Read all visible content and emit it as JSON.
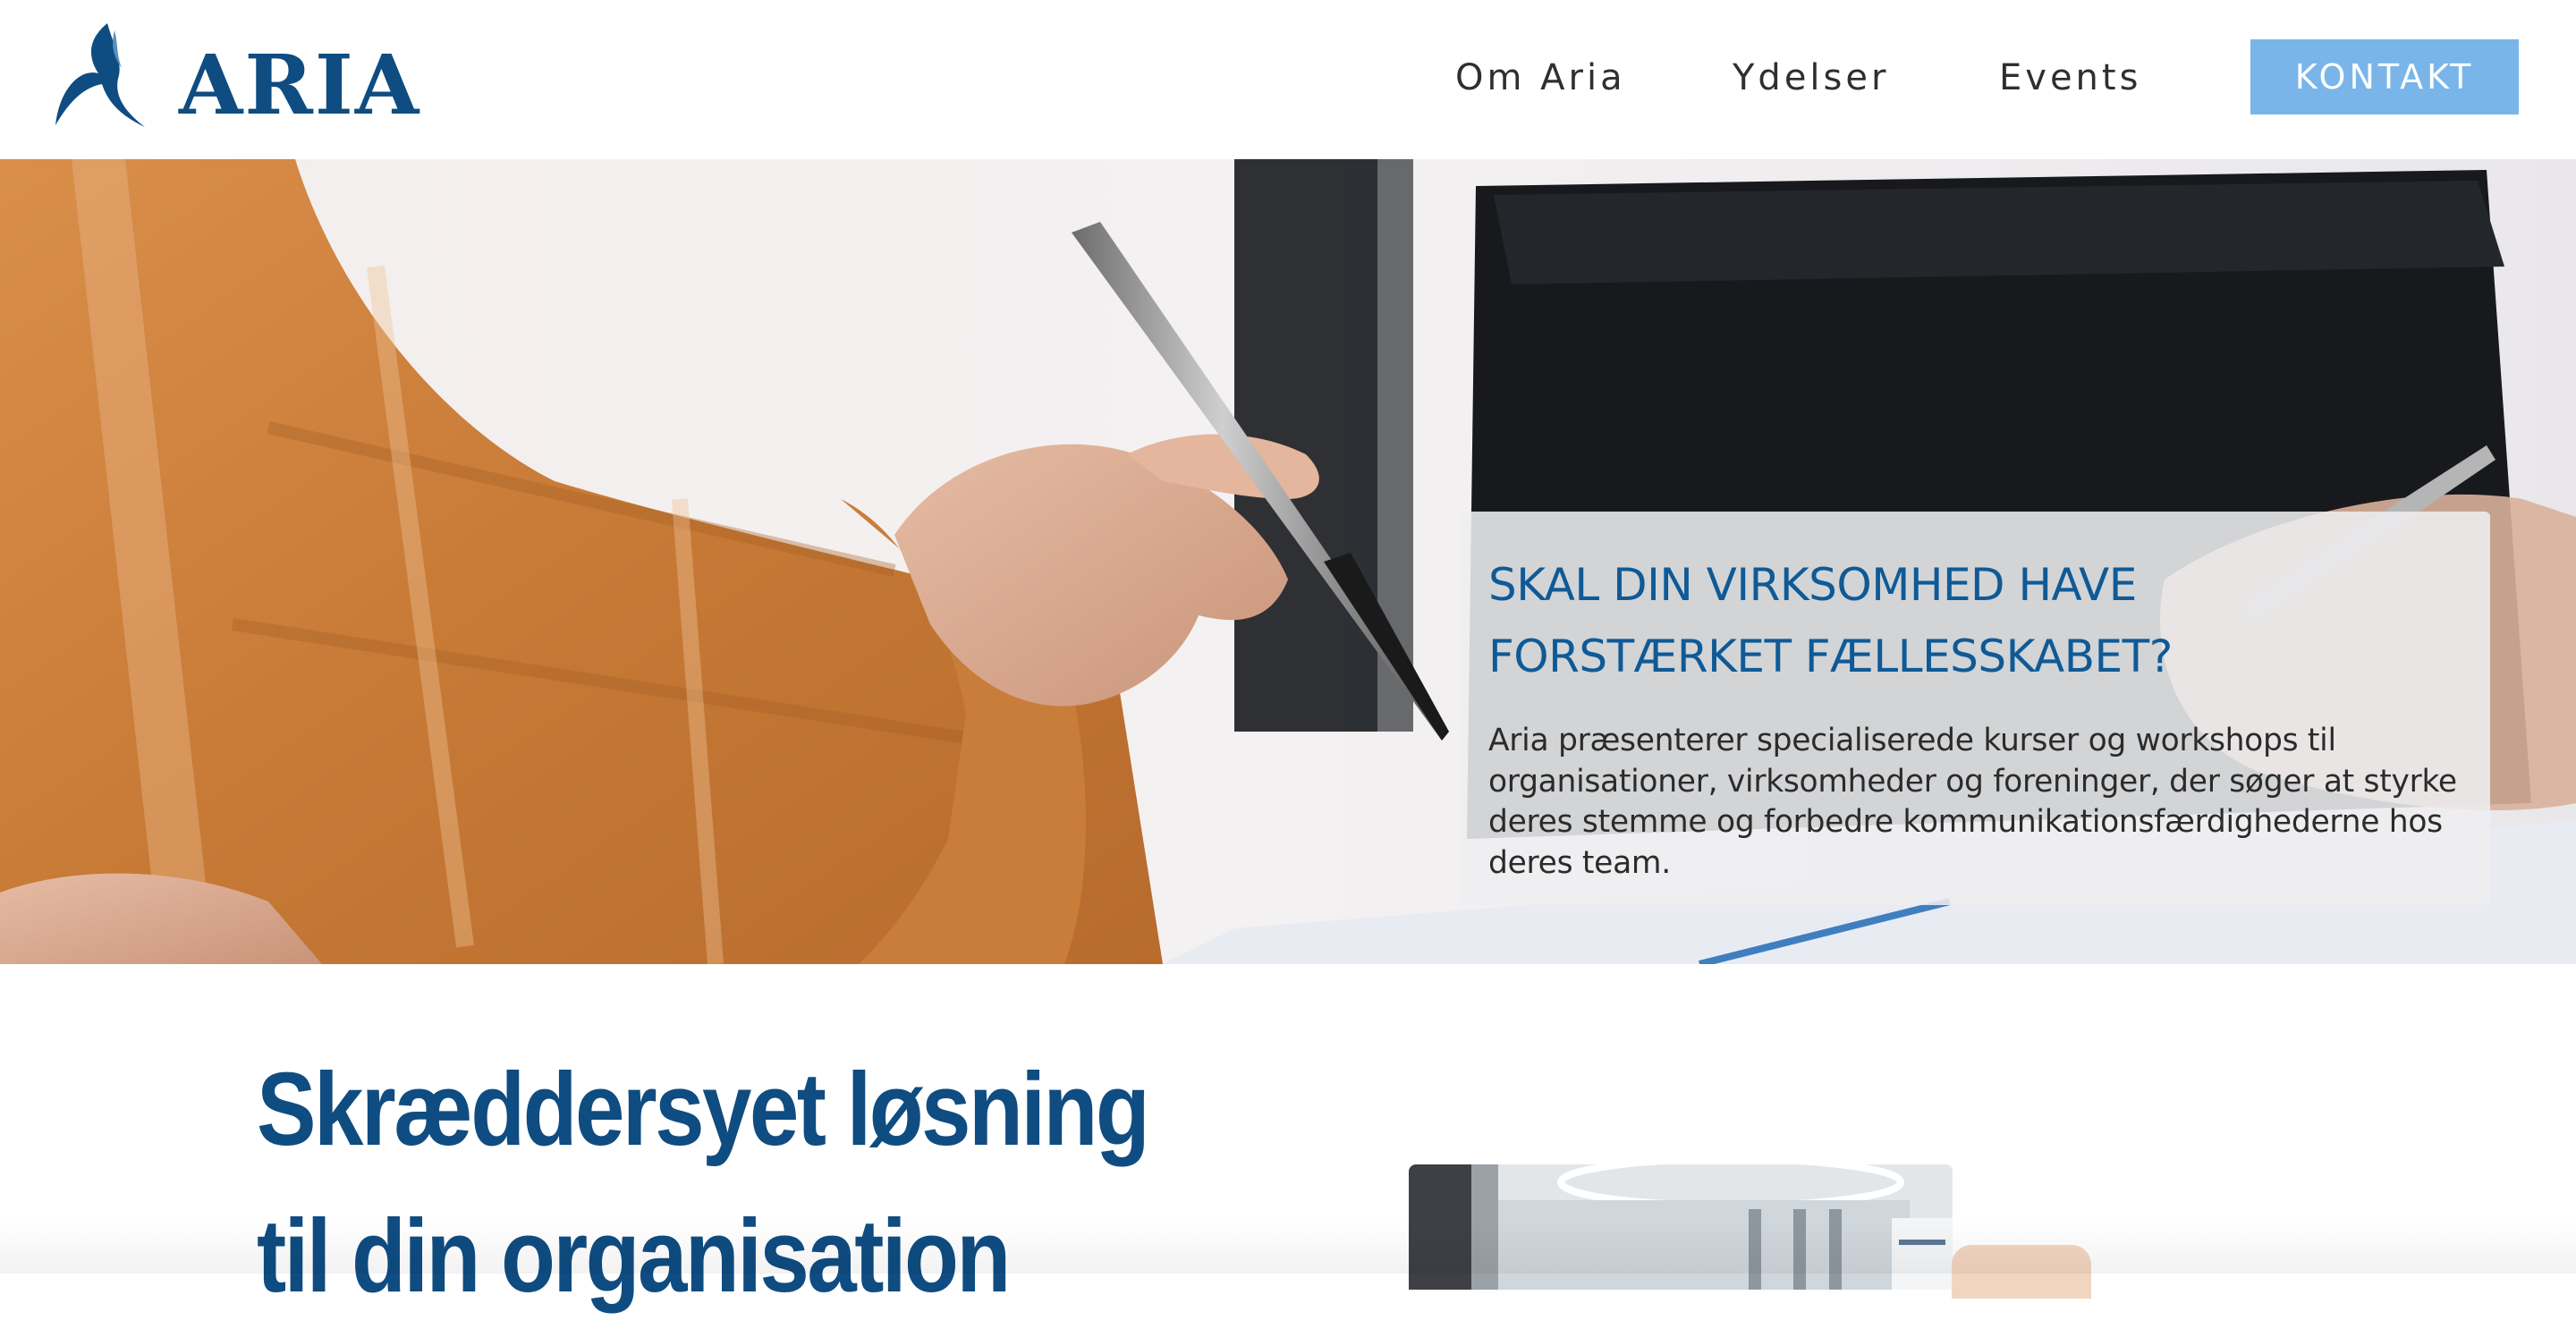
{
  "header": {
    "logo_text": "ARIA",
    "nav": {
      "om_aria": "Om Aria",
      "ydelser": "Ydelser",
      "events": "Events",
      "kontakt": "KONTAKT"
    }
  },
  "hero": {
    "title_line1": "SKAL DIN VIRKSOMHED HAVE",
    "title_line2": "FORSTÆRKET FÆLLESSKABET?",
    "body": "Aria præsenterer specialiserede kurser og workshops til organisationer, virksomheder og foreninger, der søger at styrke deres stemme og forbedre kommunikationsfærdighederne hos deres team."
  },
  "section": {
    "title": "Skræddersyet løsning til din organisation"
  },
  "colors": {
    "brand_blue": "#0f4c81",
    "hero_title_blue": "#0f5a96",
    "button_blue": "#79b5e9",
    "peach_accent": "#f2d5bf"
  },
  "icons": {
    "logo": "flame-swirl-logo"
  }
}
